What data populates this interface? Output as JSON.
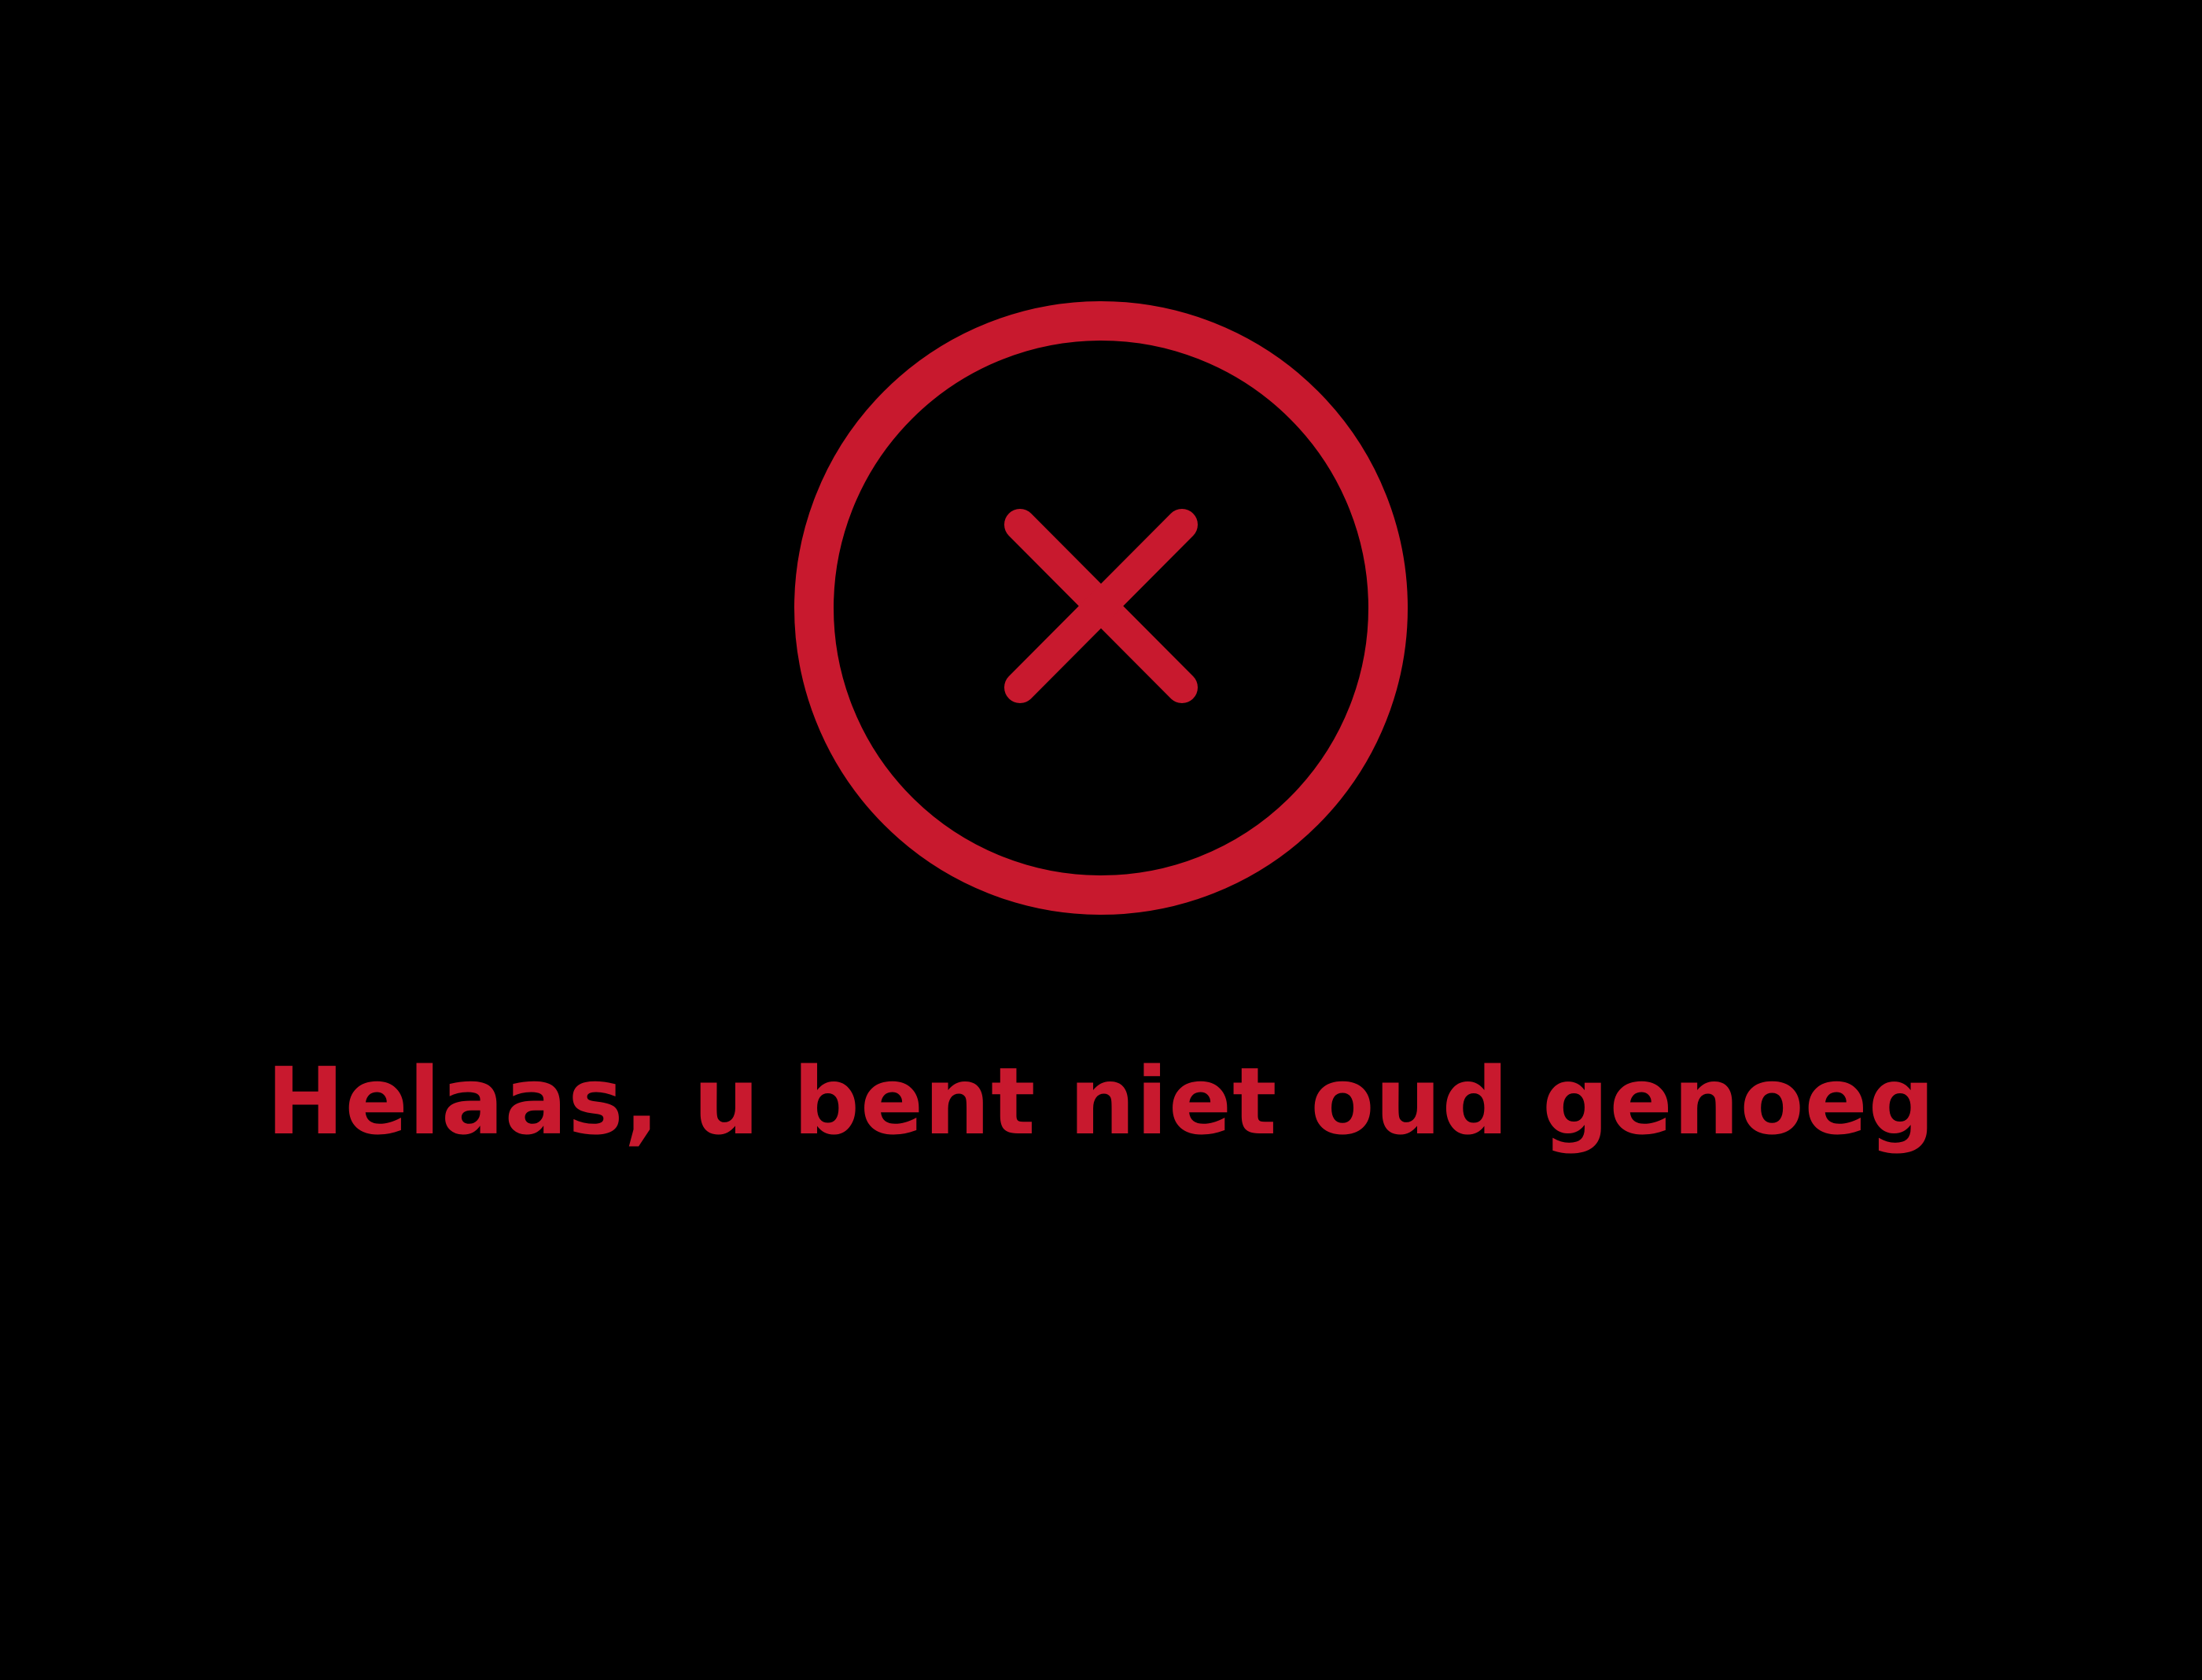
{
  "screen": {
    "background_color": "#000000",
    "accent_color": "#c8192e",
    "icon": "close-circle-icon",
    "message": "Helaas, u bent niet oud genoeg"
  }
}
